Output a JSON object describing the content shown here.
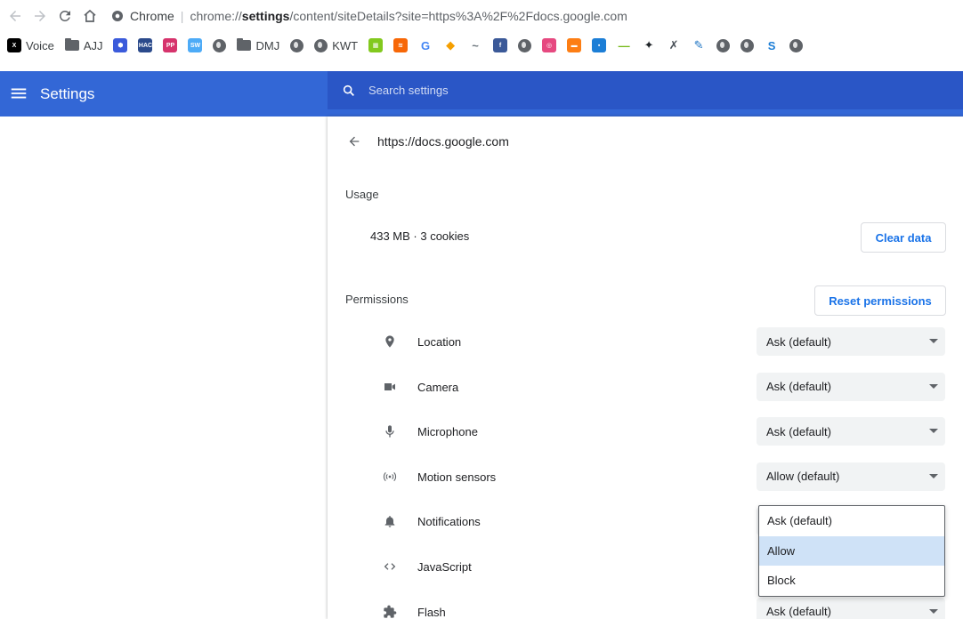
{
  "browser": {
    "chip_label": "Chrome",
    "url_pre": "chrome://",
    "url_strong": "settings",
    "url_post": "/content/siteDetails?site=https%3A%2F%2Fdocs.google.com"
  },
  "bookmarks": [
    {
      "label": "Voice",
      "icon": "x-logo-icon",
      "color": "#000000",
      "text": "X"
    },
    {
      "label": "AJJ",
      "icon": "folder-icon"
    },
    {
      "label": "",
      "icon": "hexagon-icon",
      "color": "#3b5bdb",
      "text": "⬢"
    },
    {
      "label": "",
      "icon": "hac-icon",
      "color": "#2b4a8b",
      "text": "HAC"
    },
    {
      "label": "",
      "icon": "pp-icon",
      "color": "#d6336c",
      "text": "PP"
    },
    {
      "label": "",
      "icon": "swf-icon",
      "color": "#4dabf7",
      "text": "SW"
    },
    {
      "label": "",
      "icon": "globe-icon"
    },
    {
      "label": "DMJ",
      "icon": "folder-icon"
    },
    {
      "label": "",
      "icon": "globe-icon"
    },
    {
      "label": "KWT",
      "icon": "globe-icon"
    },
    {
      "label": "",
      "icon": "grid-icon",
      "color": "#82c91e",
      "text": "▦"
    },
    {
      "label": "",
      "icon": "stripes-icon",
      "color": "#f76707",
      "text": "≋"
    },
    {
      "label": "",
      "icon": "google-g-icon",
      "color": "#ffffff",
      "text": "G",
      "fg": "#4285f4"
    },
    {
      "label": "",
      "icon": "diamond-icon",
      "color": "#ffffff",
      "text": "◆",
      "fg": "#f59f00"
    },
    {
      "label": "",
      "icon": "signature-icon",
      "color": "#ffffff",
      "text": "~",
      "fg": "#6c757d"
    },
    {
      "label": "",
      "icon": "facebook-icon",
      "color": "#3b5998",
      "text": "f"
    },
    {
      "label": "",
      "icon": "globe-icon"
    },
    {
      "label": "",
      "icon": "instagram-icon",
      "color": "#e64980",
      "text": "◎"
    },
    {
      "label": "",
      "icon": "bag-icon",
      "color": "#fd7e14",
      "text": "▬"
    },
    {
      "label": "",
      "icon": "chat-icon",
      "color": "#1c7ed6",
      "text": "▪"
    },
    {
      "label": "",
      "icon": "dash-icon",
      "color": "#ffffff",
      "text": "—",
      "fg": "#74b816"
    },
    {
      "label": "",
      "icon": "sparkle-icon",
      "color": "#ffffff",
      "text": "✦",
      "fg": "#212529"
    },
    {
      "label": "",
      "icon": "script-icon",
      "color": "#ffffff",
      "text": "✗",
      "fg": "#495057"
    },
    {
      "label": "",
      "icon": "feather-icon",
      "color": "#ffffff",
      "text": "✎",
      "fg": "#1971c2"
    },
    {
      "label": "",
      "icon": "globe-icon"
    },
    {
      "label": "",
      "icon": "globe-icon"
    },
    {
      "label": "",
      "icon": "s-logo-icon",
      "color": "#ffffff",
      "text": "S",
      "fg": "#1c7ed6"
    },
    {
      "label": "",
      "icon": "globe-icon"
    }
  ],
  "header": {
    "title": "Settings",
    "search_placeholder": "Search settings"
  },
  "site": {
    "title": "https://docs.google.com"
  },
  "usage": {
    "label": "Usage",
    "value": "433 MB · 3 cookies",
    "clear_button": "Clear data"
  },
  "permissions": {
    "label": "Permissions",
    "reset_button": "Reset permissions",
    "items": [
      {
        "name": "location",
        "label": "Location",
        "value": "Ask (default)",
        "icon": "location-pin-icon"
      },
      {
        "name": "camera",
        "label": "Camera",
        "value": "Ask (default)",
        "icon": "camera-icon"
      },
      {
        "name": "microphone",
        "label": "Microphone",
        "value": "Ask (default)",
        "icon": "microphone-icon"
      },
      {
        "name": "motion-sensors",
        "label": "Motion sensors",
        "value": "Allow (default)",
        "icon": "motion-sensor-icon"
      },
      {
        "name": "notifications",
        "label": "Notifications",
        "value": "Ask (default)",
        "icon": "bell-icon"
      },
      {
        "name": "javascript",
        "label": "JavaScript",
        "value": "",
        "icon": "code-icon"
      },
      {
        "name": "flash",
        "label": "Flash",
        "value": "Ask (default)",
        "icon": "puzzle-icon"
      }
    ]
  },
  "dropdown": {
    "options": [
      "Ask (default)",
      "Allow",
      "Block"
    ],
    "highlighted": "Allow"
  }
}
